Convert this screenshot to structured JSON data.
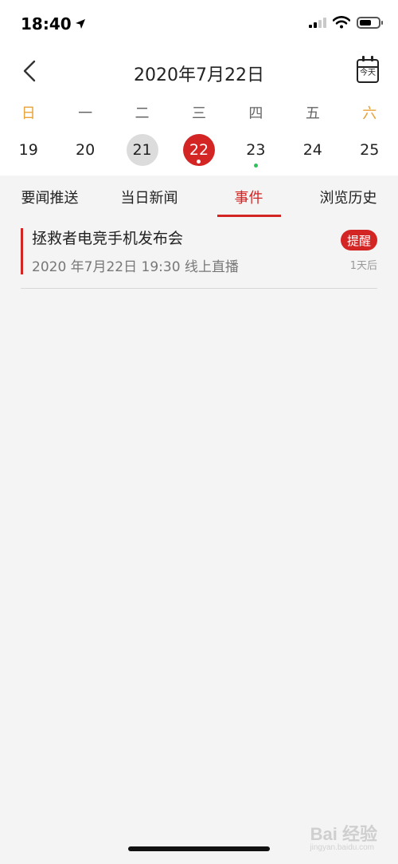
{
  "status_bar": {
    "time": "18:40",
    "icons": [
      "location-arrow-icon",
      "signal-icon",
      "wifi-icon",
      "battery-icon"
    ]
  },
  "header": {
    "title": "2020年7月22日",
    "today_label": "今天"
  },
  "week": {
    "weekdays": [
      "日",
      "一",
      "二",
      "三",
      "四",
      "五",
      "六"
    ],
    "days": [
      {
        "num": "19"
      },
      {
        "num": "20"
      },
      {
        "num": "21"
      },
      {
        "num": "22"
      },
      {
        "num": "23"
      },
      {
        "num": "24"
      },
      {
        "num": "25"
      }
    ]
  },
  "tabs": [
    {
      "label": "要闻推送"
    },
    {
      "label": "当日新闻"
    },
    {
      "label": "事件"
    },
    {
      "label": "浏览历史"
    }
  ],
  "event": {
    "title": "拯救者电竞手机发布会",
    "subtitle": "2020 年7月22日 19:30  线上直播",
    "badge": "提醒",
    "relative": "1天后"
  },
  "watermark": {
    "main": "Bai 经验",
    "sub": "jingyan.baidu.com"
  },
  "colors": {
    "accent": "#d42525",
    "weekend": "#e9a33a",
    "event_dot": "#2ec25a",
    "background": "#f4f4f4"
  }
}
